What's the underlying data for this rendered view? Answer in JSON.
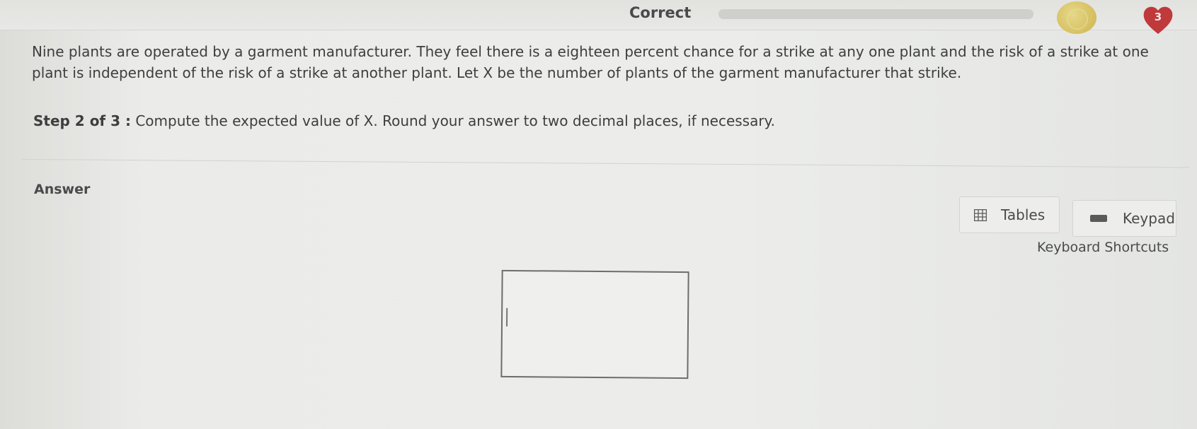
{
  "header": {
    "status": "Correct",
    "progress_fraction": 1.0,
    "hearts_count": "3"
  },
  "question": {
    "text": "Nine plants are operated by a garment manufacturer. They feel there is a eighteen percent chance for a strike at any one plant and the risk of a strike at one plant is independent of the risk of a strike at another plant. Let X be the number of plants of the garment manufacturer that strike.",
    "step_label": "Step 2 of 3 :",
    "step_text": "Compute the expected value of X. Round your answer to two decimal places, if necessary."
  },
  "answer": {
    "heading": "Answer",
    "input_value": "",
    "tables_label": "Tables",
    "keypad_label": "Keypad",
    "shortcuts_label": "Keyboard Shortcuts"
  },
  "icons": {
    "coin": "coin-icon",
    "heart": "heart-icon",
    "tables": "grid-icon",
    "keypad": "keyboard-icon"
  },
  "colors": {
    "heart": "#c0393b",
    "coin": "#d9c467"
  }
}
